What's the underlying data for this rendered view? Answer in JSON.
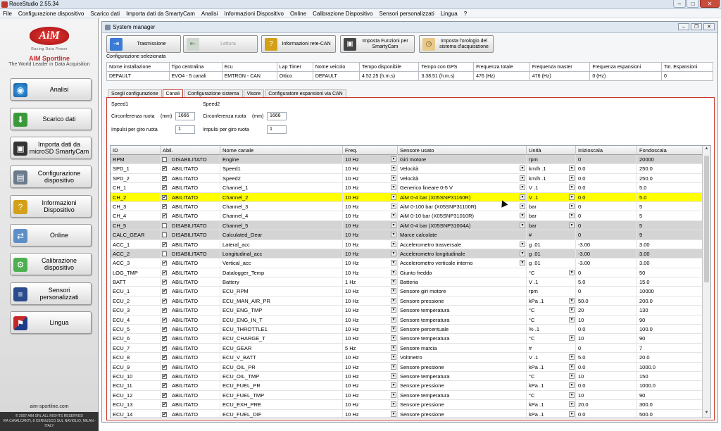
{
  "app": {
    "title": "RaceStudio 2.55.34"
  },
  "menu": [
    "File",
    "Configurazione dispositivo",
    "Scarico dati",
    "Importa dati da SmartyCam",
    "Analisi",
    "Informazioni Dispositivo",
    "Online",
    "Calibrazione Dispositivo",
    "Sensori personalizzati",
    "Lingua",
    "?"
  ],
  "sidebar": {
    "brand": "AIM Sportline",
    "tagline": "The World Leader in Data Acquisition",
    "logo_text": "AiM",
    "logo_sub": "Racing Data Power",
    "items": [
      {
        "label": "Analisi"
      },
      {
        "label": "Scarico dati"
      },
      {
        "label": "Importa dati da microSD SmartyCam"
      },
      {
        "label": "Configurazione dispositivo"
      },
      {
        "label": "Informazioni Dispositivo"
      },
      {
        "label": "Online"
      },
      {
        "label": "Calibrazione dispositivo"
      },
      {
        "label": "Sensori personalizzati"
      },
      {
        "label": "Lingua"
      }
    ],
    "site": "aim-sportline.com",
    "copyright": "© 2007 AIM SRL ALL RIGHTS RESERVED",
    "address": "VIA CAVALCANTI, 8 CERNUSCO SUL NAVIGLIO, MILAN - ITALY"
  },
  "window": {
    "title": "System manager"
  },
  "toolbar": {
    "trasmissione": "Trasmissione",
    "lettura": "Lettura",
    "rete_can": "Informazioni rete-CAN",
    "funzioni_smartycam": "Imposta Funzioni per SmartyCam",
    "orologio": "Imposta l'orologio del sistema d'acquisizione"
  },
  "config": {
    "label": "Configurazione selezionata",
    "headers": [
      "Nome installazione",
      "Tipo centralina",
      "Ecu",
      "Lap Timer",
      "Nome veicolo",
      "Tempo disponibile",
      "Tempo con GPS",
      "Frequenza totale",
      "Frequenza master",
      "Frequenza espansioni",
      "Tot. Espansioni"
    ],
    "values": [
      "DEFAULT",
      "EVO4 - 5 canali",
      "EMTRON - CAN",
      "Ottico",
      "DEFAULT",
      "4.52.25 (h.m.s)",
      "3.38.51 (h.m.s)",
      "476 (Hz)",
      "476 (Hz)",
      "0 (Hz)",
      "0"
    ]
  },
  "tabs": [
    "Scegli configurazione",
    "Canali",
    "Configurazione sistema",
    "Visore",
    "Configuratore espansioni via CAN"
  ],
  "speed": [
    {
      "title": "Speed1",
      "circ_label": "Circonferenza ruota",
      "unit": "(mm)",
      "circ": "1666",
      "imp_label": "Impulsi per giro ruota",
      "imp": "1"
    },
    {
      "title": "Speed2",
      "circ_label": "Circonferenza ruota",
      "unit": "(mm)",
      "circ": "1666",
      "imp_label": "Impulsi per giro ruota",
      "imp": "1"
    }
  ],
  "grid": {
    "headers": [
      "ID",
      "Abil.",
      "Nome canale",
      "Freq.",
      "Sensore usato",
      "Unità",
      "Inizioscala",
      "Fondoscala"
    ],
    "rows": [
      {
        "id": "RPM",
        "chk": "",
        "abil": "DISABILITATO",
        "nome": "Engine",
        "freq": "10 Hz",
        "sensore": "Giri motore",
        "unita": "rpm",
        "ini": "0",
        "fondo": "20000",
        "style": "gray",
        "sdd": false,
        "udd": false
      },
      {
        "id": "SPD_1",
        "chk": "✔",
        "abil": "ABILITATO",
        "nome": "Speed1",
        "freq": "10 Hz",
        "sensore": "Velocità",
        "unita": "km/h .1",
        "ini": "0.0",
        "fondo": "250.0",
        "style": "",
        "sdd": true,
        "udd": true
      },
      {
        "id": "SPD_2",
        "chk": "✔",
        "abil": "ABILITATO",
        "nome": "Speed2",
        "freq": "10 Hz",
        "sensore": "Velocità",
        "unita": "km/h .1",
        "ini": "0.0",
        "fondo": "250.0",
        "style": "",
        "sdd": true,
        "udd": true
      },
      {
        "id": "CH_1",
        "chk": "✔",
        "abil": "ABILITATO",
        "nome": "Channel_1",
        "freq": "10 Hz",
        "sensore": "Generico lineare 0-5 V",
        "unita": "V .1",
        "ini": "0.0",
        "fondo": "5.0",
        "style": "",
        "sdd": true,
        "udd": true
      },
      {
        "id": "CH_2",
        "chk": "✔",
        "abil": "ABILITATO",
        "nome": "Channel_2",
        "freq": "10 Hz",
        "sensore": "AiM 0-4 bar (X05SNP31160R)",
        "unita": "V .1",
        "ini": "0.0",
        "fondo": "5.0",
        "style": "hl",
        "sdd": true,
        "udd": true
      },
      {
        "id": "CH_3",
        "chk": "✔",
        "abil": "ABILITATO",
        "nome": "Channel_3",
        "freq": "10 Hz",
        "sensore": "AiM 0-100 bar (X05SNP31100R)",
        "unita": "bar",
        "ini": "0",
        "fondo": "5",
        "style": "",
        "sdd": true,
        "udd": true
      },
      {
        "id": "CH_4",
        "chk": "✔",
        "abil": "ABILITATO",
        "nome": "Channel_4",
        "freq": "10 Hz",
        "sensore": "AiM 0-10 bar (X05SNP31010R)",
        "unita": "bar",
        "ini": "0",
        "fondo": "5",
        "style": "",
        "sdd": true,
        "udd": true
      },
      {
        "id": "CH_5",
        "chk": "",
        "abil": "DISABILITATO",
        "nome": "Channel_5",
        "freq": "10 Hz",
        "sensore": "AiM 0-4 bar (X05SNP31004A)",
        "unita": "bar",
        "ini": "0",
        "fondo": "5",
        "style": "gray",
        "sdd": true,
        "udd": true
      },
      {
        "id": "CALC_GEAR",
        "chk": "",
        "abil": "DISABILITATO",
        "nome": "Calculated_Gear",
        "freq": "10 Hz",
        "sensore": "Marce calcolate",
        "unita": "#",
        "ini": "0",
        "fondo": "9",
        "style": "gray",
        "sdd": false,
        "udd": false
      },
      {
        "id": "ACC_1",
        "chk": "✔",
        "abil": "ABILITATO",
        "nome": "Lateral_acc",
        "freq": "10 Hz",
        "sensore": "Accelerometro trasversale",
        "unita": "g .01",
        "ini": "-3.00",
        "fondo": "3.00",
        "style": "",
        "sdd": true,
        "udd": false
      },
      {
        "id": "ACC_2",
        "chk": "",
        "abil": "DISABILITATO",
        "nome": "Longitudinal_acc",
        "freq": "10 Hz",
        "sensore": "Accelerometro longitudinale",
        "unita": "g .01",
        "ini": "-3.00",
        "fondo": "3.00",
        "style": "gray",
        "sdd": true,
        "udd": false
      },
      {
        "id": "ACC_3",
        "chk": "✔",
        "abil": "ABILITATO",
        "nome": "Vertical_acc",
        "freq": "10 Hz",
        "sensore": "Accelerometro verticale interno",
        "unita": "g .01",
        "ini": "-3.00",
        "fondo": "3.00",
        "style": "",
        "sdd": true,
        "udd": false
      },
      {
        "id": "LOG_TMP",
        "chk": "✔",
        "abil": "ABILITATO",
        "nome": "Datalogger_Temp",
        "freq": "10 Hz",
        "sensore": "Giunto freddo",
        "unita": "°C",
        "ini": "0",
        "fondo": "50",
        "style": "",
        "sdd": false,
        "udd": true
      },
      {
        "id": "BATT",
        "chk": "✔",
        "abil": "ABILITATO",
        "nome": "Battery",
        "freq": "1 Hz",
        "sensore": "Batteria",
        "unita": "V .1",
        "ini": "5.0",
        "fondo": "15.0",
        "style": "",
        "sdd": false,
        "udd": false
      },
      {
        "id": "ECU_1",
        "chk": "✔",
        "abil": "ABILITATO",
        "nome": "ECU_RPM",
        "freq": "10 Hz",
        "sensore": "Sensore giri motore",
        "unita": "rpm",
        "ini": "0",
        "fondo": "10000",
        "style": "",
        "sdd": false,
        "udd": false
      },
      {
        "id": "ECU_2",
        "chk": "✔",
        "abil": "ABILITATO",
        "nome": "ECU_MAN_AIR_PR",
        "freq": "10 Hz",
        "sensore": "Sensore pressione",
        "unita": "kPa .1",
        "ini": "50.0",
        "fondo": "200.0",
        "style": "",
        "sdd": false,
        "udd": true
      },
      {
        "id": "ECU_3",
        "chk": "✔",
        "abil": "ABILITATO",
        "nome": "ECU_ENG_TMP",
        "freq": "10 Hz",
        "sensore": "Sensore temperatura",
        "unita": "°C",
        "ini": "20",
        "fondo": "130",
        "style": "",
        "sdd": false,
        "udd": true
      },
      {
        "id": "ECU_4",
        "chk": "✔",
        "abil": "ABILITATO",
        "nome": "ECU_ENG_IN_T",
        "freq": "10 Hz",
        "sensore": "Sensore temperatura",
        "unita": "°C",
        "ini": "10",
        "fondo": "90",
        "style": "",
        "sdd": false,
        "udd": true
      },
      {
        "id": "ECU_5",
        "chk": "✔",
        "abil": "ABILITATO",
        "nome": "ECU_THROTTLE1",
        "freq": "10 Hz",
        "sensore": "Sensore percentuale",
        "unita": "% .1",
        "ini": "0.0",
        "fondo": "100.0",
        "style": "",
        "sdd": false,
        "udd": false
      },
      {
        "id": "ECU_6",
        "chk": "✔",
        "abil": "ABILITATO",
        "nome": "ECU_CHARGE_T",
        "freq": "10 Hz",
        "sensore": "Sensore temperatura",
        "unita": "°C",
        "ini": "10",
        "fondo": "90",
        "style": "",
        "sdd": false,
        "udd": true
      },
      {
        "id": "ECU_7",
        "chk": "✔",
        "abil": "ABILITATO",
        "nome": "ECU_GEAR",
        "freq": "5 Hz",
        "sensore": "Sensore marcia",
        "unita": "#",
        "ini": "0",
        "fondo": "7",
        "style": "",
        "sdd": false,
        "udd": false
      },
      {
        "id": "ECU_8",
        "chk": "✔",
        "abil": "ABILITATO",
        "nome": "ECU_V_BATT",
        "freq": "10 Hz",
        "sensore": "Voltmetro",
        "unita": "V .1",
        "ini": "5.0",
        "fondo": "20.0",
        "style": "",
        "sdd": false,
        "udd": true
      },
      {
        "id": "ECU_9",
        "chk": "✔",
        "abil": "ABILITATO",
        "nome": "ECU_OIL_PR",
        "freq": "10 Hz",
        "sensore": "Sensore pressione",
        "unita": "kPa .1",
        "ini": "0.0",
        "fondo": "1000.0",
        "style": "",
        "sdd": false,
        "udd": true
      },
      {
        "id": "ECU_10",
        "chk": "✔",
        "abil": "ABILITATO",
        "nome": "ECU_OIL_TMP",
        "freq": "10 Hz",
        "sensore": "Sensore temperatura",
        "unita": "°C",
        "ini": "10",
        "fondo": "150",
        "style": "",
        "sdd": false,
        "udd": true
      },
      {
        "id": "ECU_11",
        "chk": "✔",
        "abil": "ABILITATO",
        "nome": "ECU_FUEL_PR",
        "freq": "10 Hz",
        "sensore": "Sensore pressione",
        "unita": "kPa .1",
        "ini": "0.0",
        "fondo": "1000.0",
        "style": "",
        "sdd": false,
        "udd": true
      },
      {
        "id": "ECU_12",
        "chk": "✔",
        "abil": "ABILITATO",
        "nome": "ECU_FUEL_TMP",
        "freq": "10 Hz",
        "sensore": "Sensore temperatura",
        "unita": "°C",
        "ini": "10",
        "fondo": "90",
        "style": "",
        "sdd": false,
        "udd": true
      },
      {
        "id": "ECU_13",
        "chk": "✔",
        "abil": "ABILITATO",
        "nome": "ECU_EXH_PRE",
        "freq": "10 Hz",
        "sensore": "Sensore pressione",
        "unita": "kPa .1",
        "ini": "20.0",
        "fondo": "300.0",
        "style": "",
        "sdd": false,
        "udd": true
      },
      {
        "id": "ECU_14",
        "chk": "✔",
        "abil": "ABILITATO",
        "nome": "ECU_FUEL_DIF",
        "freq": "10 Hz",
        "sensore": "Sensore pressione",
        "unita": "kPa .1",
        "ini": "0.0",
        "fondo": "500.0",
        "style": "",
        "sdd": false,
        "udd": true
      }
    ]
  }
}
